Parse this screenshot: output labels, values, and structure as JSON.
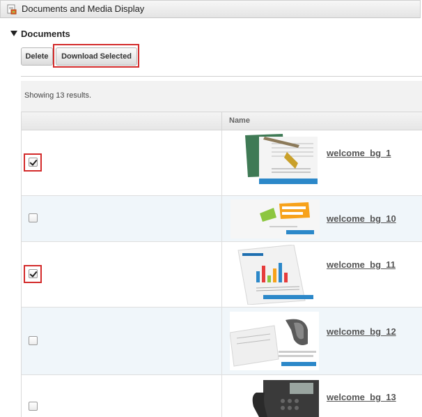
{
  "portlet": {
    "title": "Documents and Media Display",
    "icon": "document-media-icon"
  },
  "panel": {
    "title": "Documents",
    "toggle_icon": "collapse-triangle-icon"
  },
  "toolbar": {
    "delete_label": "Delete",
    "download_label": "Download Selected"
  },
  "results": {
    "text": "Showing 13 results."
  },
  "table": {
    "columns": [
      "",
      "Name"
    ],
    "rows": [
      {
        "name": "welcome_bg_1",
        "checked": true,
        "highlighted": true
      },
      {
        "name": "welcome_bg_10",
        "checked": false,
        "highlighted": false
      },
      {
        "name": "welcome_bg_11",
        "checked": true,
        "highlighted": true
      },
      {
        "name": "welcome_bg_12",
        "checked": false,
        "highlighted": false
      },
      {
        "name": "welcome_bg_13",
        "checked": false,
        "highlighted": false
      }
    ]
  },
  "colors": {
    "highlight": "#d32a2a",
    "alt_row": "#f0f6fa",
    "link": "#555555"
  }
}
